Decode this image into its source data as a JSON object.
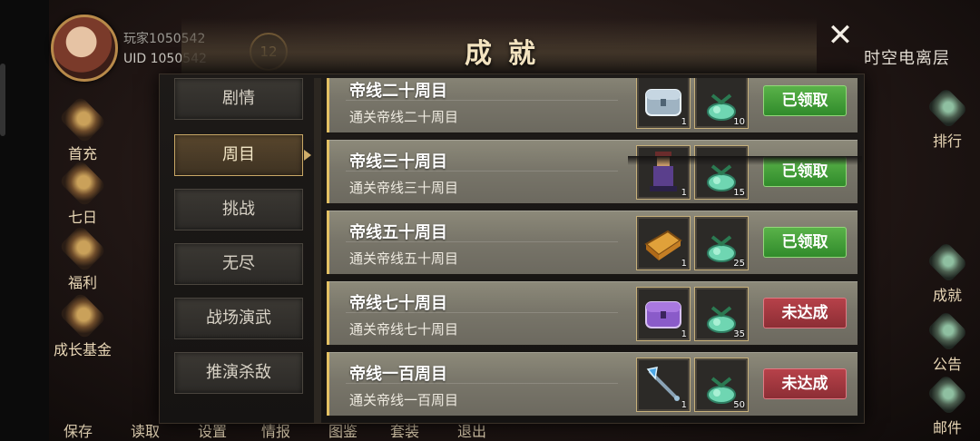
{
  "player": {
    "name": "玩家1050542",
    "uid": "UID  1050542",
    "level": "12"
  },
  "zone": "时空电离层",
  "left_menu": [
    "首充",
    "七日",
    "福利",
    "成长基金"
  ],
  "right_menu": [
    "排行",
    "成就",
    "公告",
    "邮件"
  ],
  "bottom_nav": [
    "保存",
    "读取",
    "设置",
    "情报",
    "图鉴",
    "套装",
    "退出"
  ],
  "panel": {
    "title": "成就",
    "close_label": "✕",
    "tabs": [
      "剧情",
      "周目",
      "挑战",
      "无尽",
      "战场演武",
      "推演杀敌"
    ],
    "active_tab": "周目",
    "rows": [
      {
        "name": "帝线二十周目",
        "desc": "通关帝线二十周目",
        "item1_icon": "silver-chest-icon",
        "item1_count": "1",
        "item2_icon": "jade-ingot-icon",
        "item2_count": "10",
        "status": "已领取",
        "state": "claimed"
      },
      {
        "name": "帝线三十周目",
        "desc": "通关帝线三十周目",
        "item1_icon": "general-figure-icon",
        "item1_count": "1",
        "item2_icon": "jade-ingot-icon",
        "item2_count": "15",
        "status": "已领取",
        "state": "claimed"
      },
      {
        "name": "帝线五十周目",
        "desc": "通关帝线五十周目",
        "item1_icon": "book-icon",
        "item1_count": "1",
        "item2_icon": "jade-ingot-icon",
        "item2_count": "25",
        "status": "已领取",
        "state": "claimed"
      },
      {
        "name": "帝线七十周目",
        "desc": "通关帝线七十周目",
        "item1_icon": "purple-chest-icon",
        "item1_count": "1",
        "item2_icon": "jade-ingot-icon",
        "item2_count": "35",
        "status": "未达成",
        "state": "locked"
      },
      {
        "name": "帝线一百周目",
        "desc": "通关帝线一百周目",
        "item1_icon": "halberd-icon",
        "item1_count": "1",
        "item2_icon": "jade-ingot-icon",
        "item2_count": "50",
        "status": "未达成",
        "state": "locked"
      }
    ]
  },
  "colors": {
    "accent_gold": "#e4c164",
    "claimed_green": "#3f9a35",
    "locked_red": "#a53840"
  }
}
